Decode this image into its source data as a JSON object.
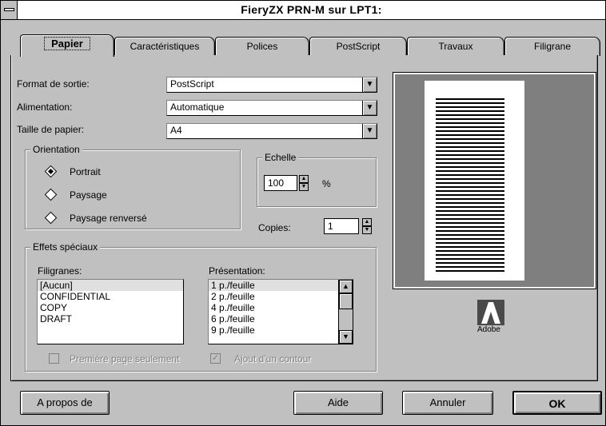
{
  "window": {
    "title": "FieryZX PRN-M sur LPT1:"
  },
  "tabs": [
    {
      "label": "Papier",
      "active": true
    },
    {
      "label": "Caractéristiques"
    },
    {
      "label": "Polices"
    },
    {
      "label": "PostScript"
    },
    {
      "label": "Travaux"
    },
    {
      "label": "Filigrane"
    }
  ],
  "fields": {
    "format_label": "Format de sortie:",
    "format_value": "PostScript",
    "alimentation_label": "Alimentation:",
    "alimentation_value": "Automatique",
    "taille_label": "Taille de papier:",
    "taille_value": "A4"
  },
  "orientation": {
    "legend": "Orientation",
    "options": [
      "Portrait",
      "Paysage",
      "Paysage renversé"
    ],
    "selected": "Portrait"
  },
  "echelle": {
    "legend": "Echelle",
    "value": "100",
    "unit": "%"
  },
  "copies": {
    "label": "Copies:",
    "value": "1"
  },
  "effets": {
    "legend": "Effets spéciaux",
    "filigranes_label": "Filigranes:",
    "filigranes": [
      "[Aucun]",
      "CONFIDENTIAL",
      "COPY",
      "DRAFT"
    ],
    "filigranes_selected": "[Aucun]",
    "presentation_label": "Présentation:",
    "presentation": [
      "1 p./feuille",
      "2 p./feuille",
      "4 p./feuille",
      "6 p./feuille",
      "9 p./feuille"
    ],
    "presentation_selected": "1 p./feuille",
    "premiere_page_label": "Première page seulement",
    "ajout_contour_label": "Ajout d'un contour",
    "ajout_contour_checked": true
  },
  "preview": {
    "logo_text": "Adobe"
  },
  "buttons": {
    "about": "A propos de",
    "help": "Aide",
    "cancel": "Annuler",
    "ok": "OK"
  }
}
